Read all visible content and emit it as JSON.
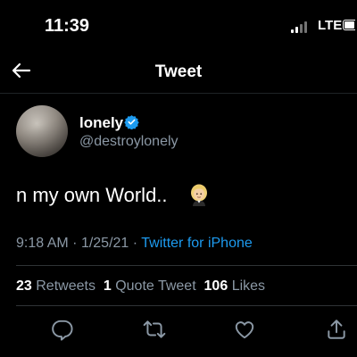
{
  "status_bar": {
    "time": "11:39",
    "network": "LTE"
  },
  "nav": {
    "title": "Tweet"
  },
  "author": {
    "name": "lonely",
    "handle": "@destroylonely",
    "verified": true
  },
  "tweet": {
    "text": "n my own World..",
    "emoji": "person-with-blond-hair"
  },
  "meta": {
    "time": "9:18 AM",
    "separator": "·",
    "date": "1/25/21",
    "source": "Twitter for iPhone"
  },
  "stats": {
    "retweets_count": "23",
    "retweets_label": "Retweets",
    "quote_count": "1",
    "quote_label": "Quote Tweet",
    "likes_count": "106",
    "likes_label": "Likes"
  },
  "colors": {
    "background": "#000000",
    "link": "#1d9bf0",
    "muted": "#8b98a5",
    "verified": "#1d9bf0"
  },
  "actions": [
    "reply-icon",
    "retweet-icon",
    "like-icon",
    "share-icon"
  ]
}
